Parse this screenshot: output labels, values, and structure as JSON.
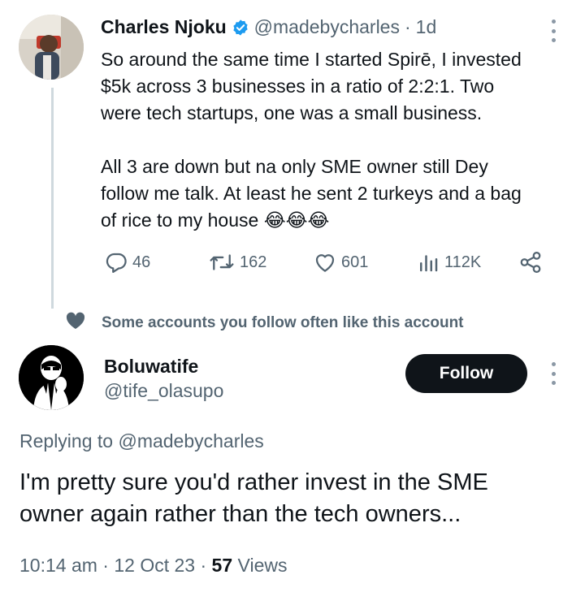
{
  "tweet1": {
    "name": "Charles Njoku",
    "handle": "@madebycharles",
    "separator": "·",
    "time": "1d",
    "body_lines": [
      "So around the same time I started Spirē, I invested",
      "$5k across 3 businesses in a ratio of 2:2:1. Two",
      "were tech startups, one was a small business.",
      "All 3 are down but na only SME owner still Dey",
      "follow me talk. At least he sent 2 turkeys and a bag",
      "of rice to my house"
    ],
    "emoji": "😂😂😂",
    "stats": {
      "replies": "46",
      "retweets": "162",
      "likes": "601",
      "views": "112K"
    }
  },
  "social_context": "Some accounts you follow often like this account",
  "tweet2": {
    "name": "Boluwatife",
    "handle": "@tife_olasupo",
    "follow_label": "Follow",
    "replying_prefix": "Replying to",
    "replying_to": "@madebycharles",
    "body_lines": [
      "I'm pretty sure you'd rather invest in the SME",
      "owner again rather than the tech owners..."
    ],
    "time": "10:14 am",
    "date": "12 Oct 23",
    "separator": "·",
    "views_count": "57",
    "views_label": "Views"
  },
  "colors": {
    "text": "#0f1419",
    "secondary": "#536471",
    "verified": "#1d9bf0",
    "thread_line": "#cfd9de",
    "button": "#0f1419"
  },
  "icons": [
    "verified-badge-icon",
    "more-options-icon",
    "reply-icon",
    "retweet-icon",
    "like-icon",
    "views-icon",
    "share-icon",
    "heart-icon"
  ]
}
